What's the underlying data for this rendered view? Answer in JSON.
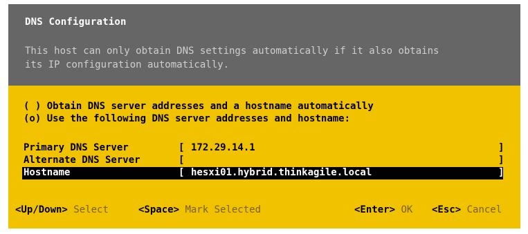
{
  "dialog": {
    "title": "DNS Configuration",
    "description": "This host can only obtain DNS settings automatically if it also obtains\nits IP configuration automatically."
  },
  "options": [
    {
      "marker": "( )",
      "label": "Obtain DNS server addresses and a hostname automatically",
      "selected": false
    },
    {
      "marker": "(o)",
      "label": "Use the following DNS server addresses and hostname:",
      "selected": true
    }
  ],
  "fields": [
    {
      "label": "Primary DNS Server",
      "value": "172.29.14.1",
      "focused": false
    },
    {
      "label": "Alternate DNS Server",
      "value": "",
      "focused": false
    },
    {
      "label": "Hostname",
      "value": "hesxi01.hybrid.thinkagile.local",
      "focused": true
    }
  ],
  "footer": {
    "updown_key": "<Up/Down>",
    "updown_action": "Select",
    "space_key": "<Space>",
    "space_action": "Mark Selected",
    "enter_key": "<Enter>",
    "enter_action": "OK",
    "esc_key": "<Esc>",
    "esc_action": "Cancel"
  },
  "colors": {
    "header_bg": "#666666",
    "body_bg": "#f0c200",
    "selection_bg": "#000000"
  }
}
